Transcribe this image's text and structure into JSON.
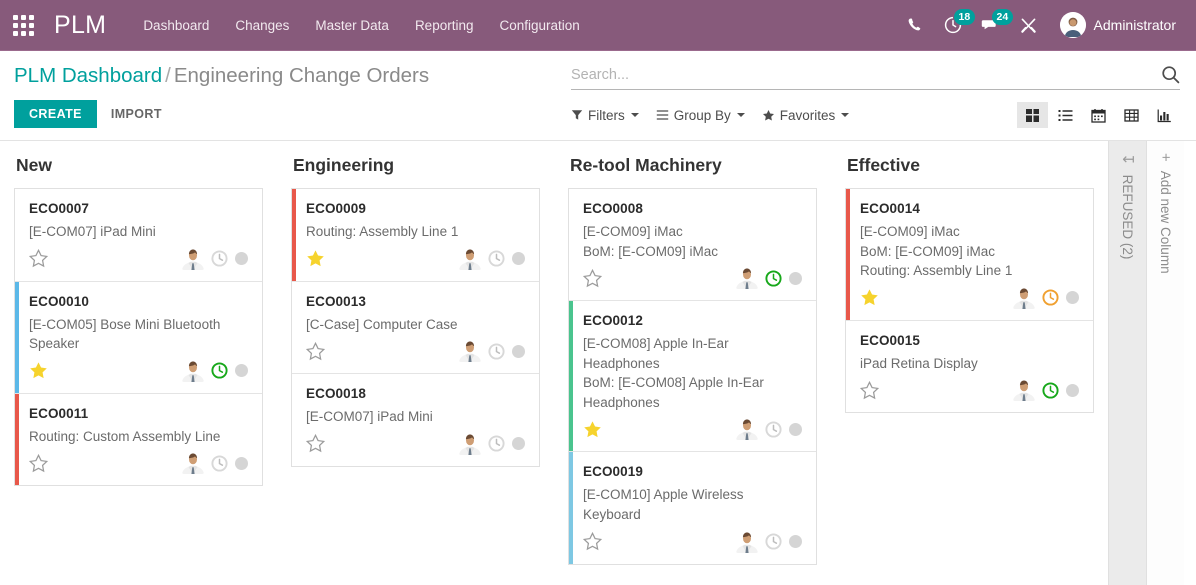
{
  "navbar": {
    "apps_icon": "apps-grid-icon",
    "brand": "PLM",
    "menu": [
      {
        "label": "Dashboard"
      },
      {
        "label": "Changes"
      },
      {
        "label": "Master Data"
      },
      {
        "label": "Reporting"
      },
      {
        "label": "Configuration"
      }
    ],
    "icons": {
      "phone": "phone-icon",
      "activity": "activity-clock-icon",
      "activity_count": "18",
      "messages": "messages-icon",
      "messages_count": "24",
      "tools": "tools-icon"
    },
    "user": {
      "name": "Administrator",
      "avatar": "user-avatar"
    },
    "colors": {
      "background": "#875a7b",
      "badge": "#00a09d"
    }
  },
  "control_panel": {
    "breadcrumb": {
      "root": "PLM Dashboard",
      "separator": "/",
      "current": "Engineering Change Orders"
    },
    "create_label": "CREATE",
    "import_label": "IMPORT",
    "search": {
      "placeholder": "Search...",
      "value": ""
    },
    "filters": [
      {
        "label": "Filters",
        "icon": "funnel-icon"
      },
      {
        "label": "Group By",
        "icon": "bars-icon"
      },
      {
        "label": "Favorites",
        "icon": "star-icon"
      }
    ],
    "views": [
      {
        "name": "kanban",
        "active": true
      },
      {
        "name": "list",
        "active": false
      },
      {
        "name": "calendar",
        "active": false
      },
      {
        "name": "pivot",
        "active": false
      },
      {
        "name": "graph",
        "active": false
      }
    ]
  },
  "kanban": {
    "columns": [
      {
        "title": "New",
        "cards": [
          {
            "name": "ECO0007",
            "lines": [
              "[E-COM07] iPad Mini"
            ],
            "bar": "none",
            "starred": false,
            "clock": "gray"
          },
          {
            "name": "ECO0010",
            "lines": [
              "[E-COM05] Bose Mini Bluetooth Speaker"
            ],
            "bar": "#5bb8e8",
            "starred": true,
            "clock": "green"
          },
          {
            "name": "ECO0011",
            "lines": [
              "Routing: Custom Assembly Line"
            ],
            "bar": "#e8584a",
            "starred": false,
            "clock": "gray"
          }
        ]
      },
      {
        "title": "Engineering",
        "cards": [
          {
            "name": "ECO0009",
            "lines": [
              "Routing: Assembly Line 1"
            ],
            "bar": "#e8584a",
            "starred": true,
            "clock": "gray"
          },
          {
            "name": "ECO0013",
            "lines": [
              "[C-Case] Computer Case"
            ],
            "bar": "none",
            "starred": false,
            "clock": "gray"
          },
          {
            "name": "ECO0018",
            "lines": [
              "[E-COM07] iPad Mini"
            ],
            "bar": "none",
            "starred": false,
            "clock": "gray"
          }
        ]
      },
      {
        "title": "Re-tool Machinery",
        "cards": [
          {
            "name": "ECO0008",
            "lines": [
              "[E-COM09] iMac",
              "BoM: [E-COM09] iMac"
            ],
            "bar": "none",
            "starred": false,
            "clock": "green"
          },
          {
            "name": "ECO0012",
            "lines": [
              "[E-COM08] Apple In-Ear Headphones",
              "BoM: [E-COM08] Apple In-Ear Headphones"
            ],
            "bar": "#4ac48e",
            "starred": true,
            "clock": "gray"
          },
          {
            "name": "ECO0019",
            "lines": [
              "[E-COM10] Apple Wireless Keyboard"
            ],
            "bar": "#7ec8e3",
            "starred": false,
            "clock": "gray"
          }
        ]
      },
      {
        "title": "Effective",
        "cards": [
          {
            "name": "ECO0014",
            "lines": [
              "[E-COM09] iMac",
              "BoM: [E-COM09] iMac",
              "Routing: Assembly Line 1"
            ],
            "bar": "#e8584a",
            "starred": true,
            "clock": "orange"
          },
          {
            "name": "ECO0015",
            "lines": [
              "iPad Retina Display"
            ],
            "bar": "none",
            "starred": false,
            "clock": "green"
          }
        ]
      }
    ],
    "folded": [
      {
        "label": "REFUSED (2)",
        "icon": "↧",
        "kind": "refused"
      },
      {
        "label": "Add new Column",
        "icon": "+",
        "kind": "addnew"
      }
    ]
  }
}
